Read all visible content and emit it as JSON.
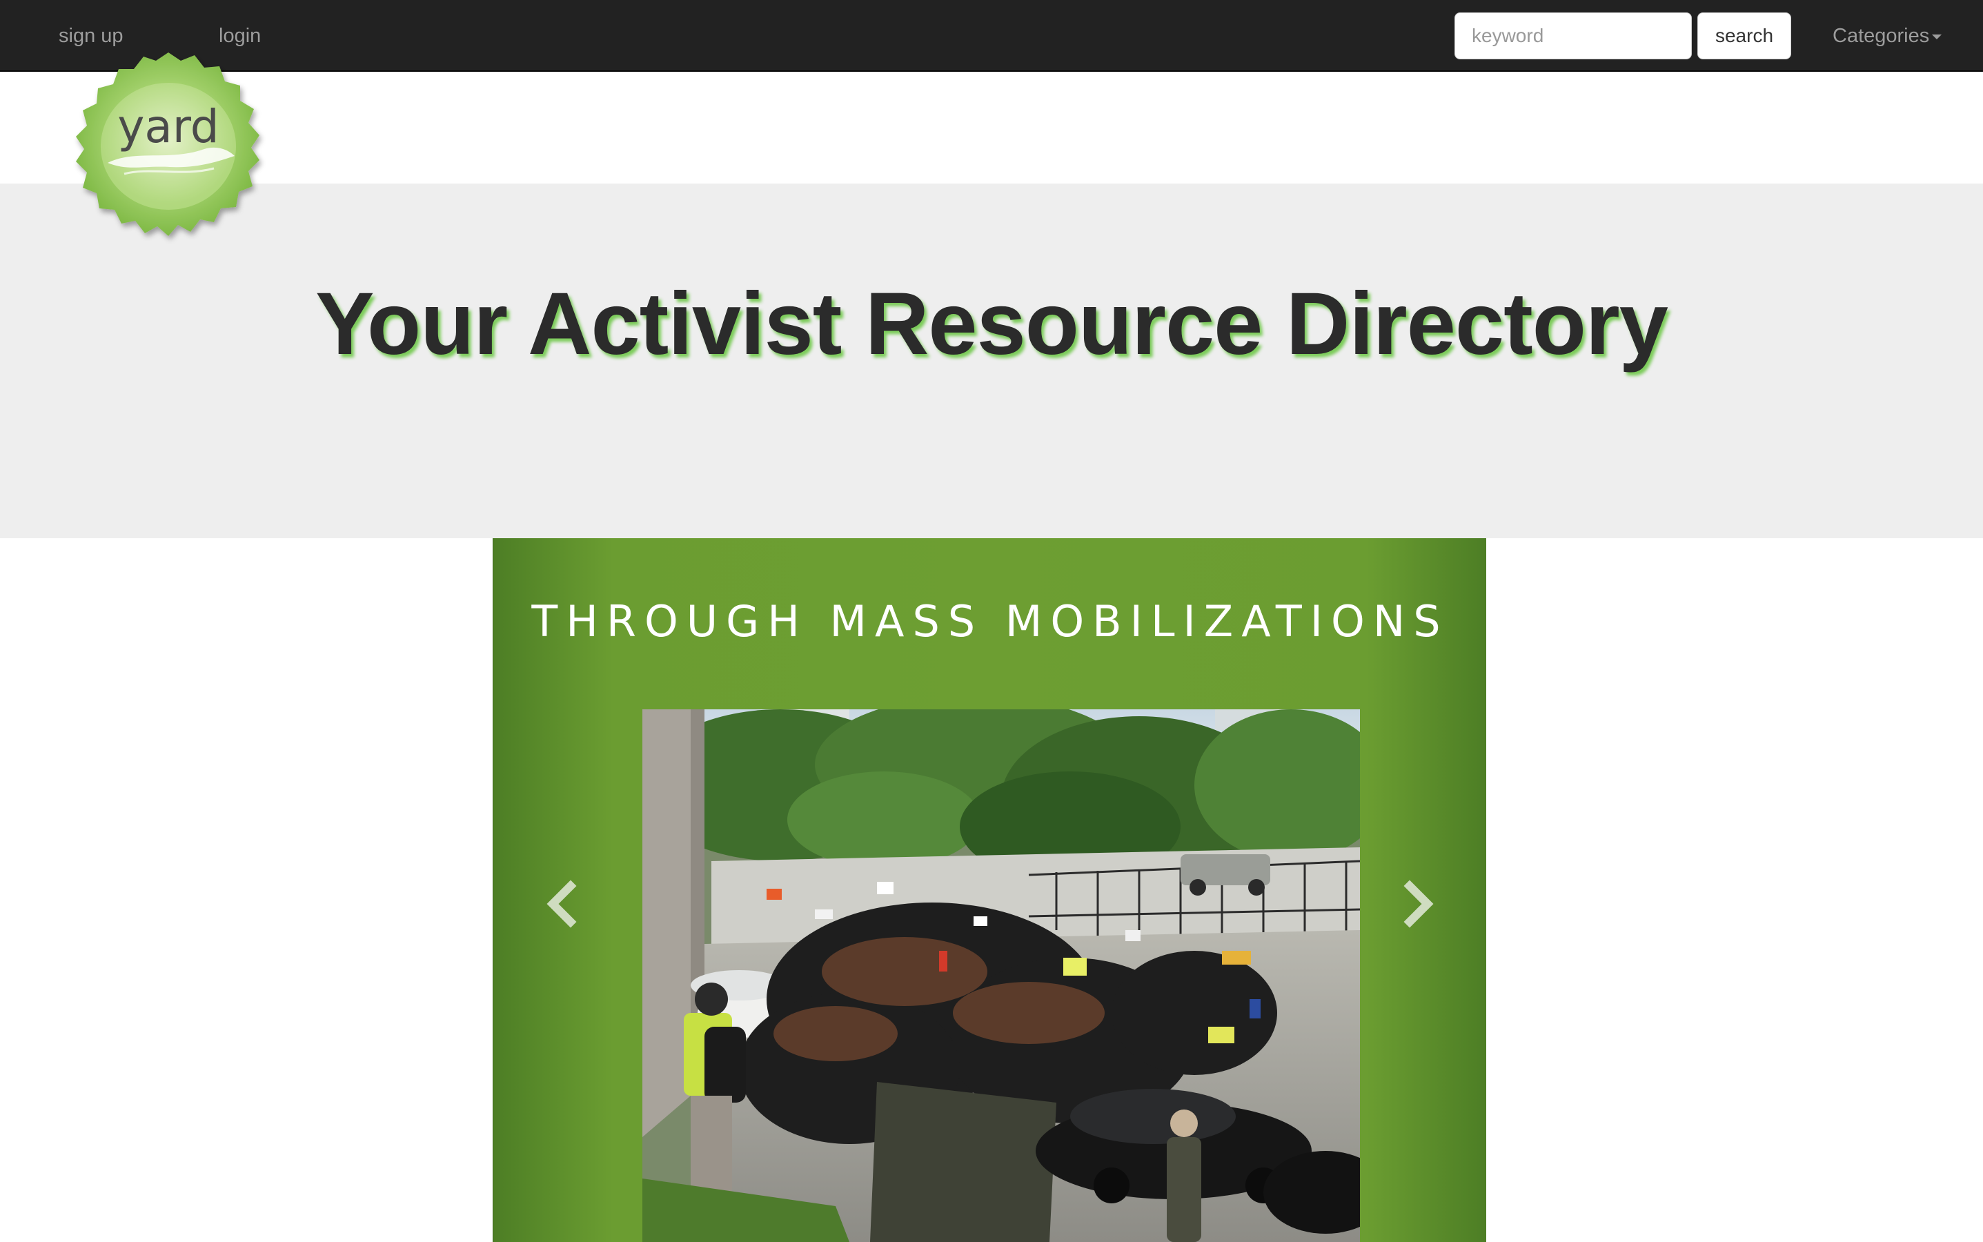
{
  "navbar": {
    "signup_label": "sign up",
    "login_label": "login",
    "search_placeholder": "keyword",
    "search_button_label": "search",
    "categories_label": "Categories",
    "background_color": "#222222",
    "link_color": "#9d9d9d"
  },
  "logo": {
    "text": "yard",
    "icon": "yard-leaf-logo",
    "color": "#8cc152"
  },
  "jumbotron": {
    "title": "Your Activist Resource Directory",
    "background_color": "#eeeeee",
    "title_shadow_color": "#7ccc5a"
  },
  "carousel": {
    "heading": "THROUGH MASS MOBILIZATIONS",
    "background_color": "#6d9e32",
    "image": "crowd-protest-photo",
    "prev_icon": "chevron-left-icon",
    "next_icon": "chevron-right-icon"
  }
}
